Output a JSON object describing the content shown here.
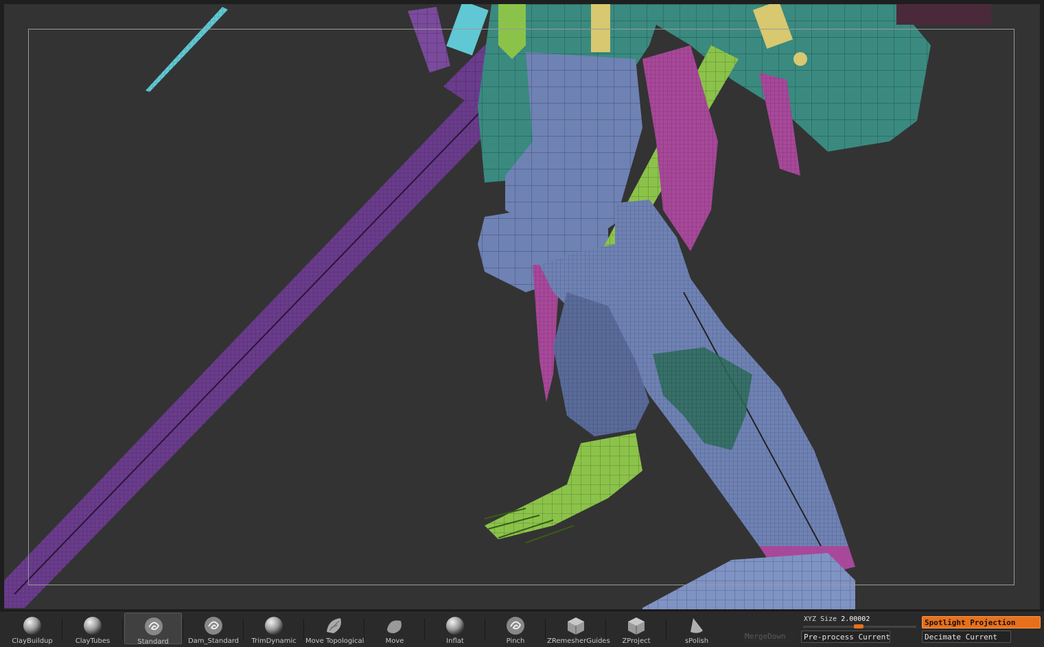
{
  "canvas": {
    "background": "#333333",
    "frame_color": "#9a9a9a"
  },
  "colors": {
    "sword": "#6a3c8c",
    "cloth": "#3a8a80",
    "armor_leg": "#6f82b4",
    "bones": "#8bc34a",
    "rags": "#a8489a",
    "spike": "#5fc8d4",
    "accent": "#e8701c"
  },
  "brushes": [
    {
      "label": "ClayBuildup",
      "icon": "sphere-brush-icon",
      "active": false
    },
    {
      "label": "ClayTubes",
      "icon": "sphere-brush-icon",
      "active": false
    },
    {
      "label": "Standard",
      "icon": "swirl-brush-icon",
      "active": true
    },
    {
      "label": "Dam_Standard",
      "icon": "swirl-brush-icon",
      "active": false
    },
    {
      "label": "TrimDynamic",
      "icon": "sphere-brush-icon",
      "active": false
    },
    {
      "label": "Move  Topological",
      "icon": "shell-brush-icon",
      "active": false
    },
    {
      "label": "Move",
      "icon": "blob-brush-icon",
      "active": false
    },
    {
      "label": "Inflat",
      "icon": "sphere-brush-icon",
      "active": false
    },
    {
      "label": "Pinch",
      "icon": "swirl-brush-icon",
      "active": false
    },
    {
      "label": "ZRemesherGuides",
      "icon": "cube-brush-icon",
      "active": false
    },
    {
      "label": "ZProject",
      "icon": "cube-brush-icon",
      "active": false
    },
    {
      "label": "sPolish",
      "icon": "cone-brush-icon",
      "active": false
    }
  ],
  "xyz": {
    "label": "XYZ Size",
    "value": "2.00002",
    "fraction": 0.45
  },
  "buttons": {
    "merge_down": "MergeDown",
    "preprocess": "Pre-process Current",
    "spotlight": "Spotlight Projection",
    "decimate": "Decimate Current"
  }
}
